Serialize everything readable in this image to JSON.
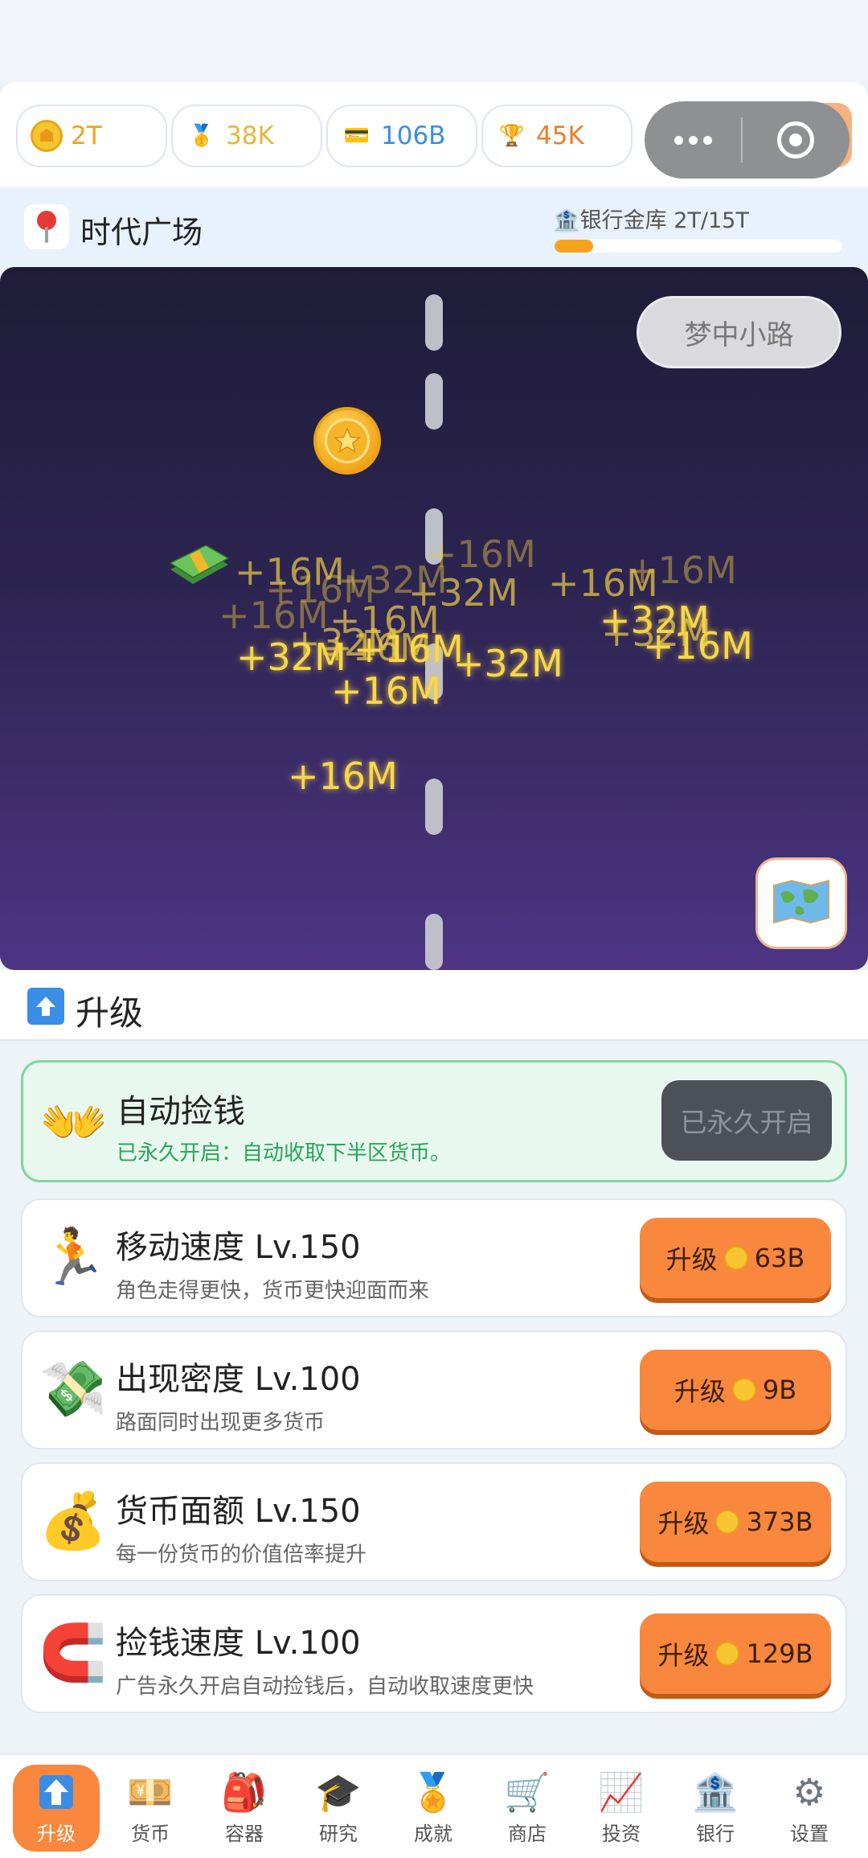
{
  "stats": [
    {
      "name": "coins",
      "icon": "coin-icon",
      "value": "2T",
      "color": "#f0a21b"
    },
    {
      "name": "medal",
      "icon": "medal-icon",
      "value": "38K",
      "color": "#e9b63a"
    },
    {
      "name": "card",
      "icon": "card-icon",
      "value": "106B",
      "color": "#3a8ee6"
    },
    {
      "name": "trophy",
      "icon": "trophy-icon",
      "value": "45K",
      "color": "#ef7d2a"
    }
  ],
  "location": {
    "name": "时代广场",
    "vault_label": "🏦银行金库  2T/15T",
    "vault_progress": 0.133
  },
  "game": {
    "place_button": "梦中小路",
    "floats": [
      "+16M",
      "+16M",
      "+32M",
      "+32M",
      "+16M",
      "+16M",
      "+32M",
      "+32M",
      "+16M",
      "+16M",
      "+32M",
      "+16M",
      "+16M",
      "+16M",
      "+16M",
      "+32M",
      "+16M",
      "+32M",
      "+16M"
    ]
  },
  "upgrade_header": "升级",
  "auto_pick": {
    "title": "自动捡钱",
    "desc": "已永久开启：自动收取下半区货币。",
    "button": "已永久开启"
  },
  "upgrades": [
    {
      "title": "移动速度  Lv.150",
      "desc": "角色走得更快，货币更快迎面而来",
      "btn_label": "升级",
      "cost": "63B",
      "icon": "runner-icon"
    },
    {
      "title": "出现密度  Lv.100",
      "desc": "路面同时出现更多货币",
      "btn_label": "升级",
      "cost": "9B",
      "icon": "money-wings-icon"
    },
    {
      "title": "货币面额  Lv.150",
      "desc": "每一份货币的价值倍率提升",
      "btn_label": "升级",
      "cost": "373B",
      "icon": "money-bag-icon"
    },
    {
      "title": "捡钱速度  Lv.100",
      "desc": "广告永久开启自动捡钱后，自动收取速度更快",
      "btn_label": "升级",
      "cost": "129B",
      "icon": "magnet-icon"
    }
  ],
  "tabs": [
    {
      "label": "升级",
      "icon": "upgrade-icon",
      "glyph": "⬆"
    },
    {
      "label": "货币",
      "icon": "currency-icon",
      "glyph": "💴"
    },
    {
      "label": "容器",
      "icon": "backpack-icon",
      "glyph": "🎒"
    },
    {
      "label": "研究",
      "icon": "graduation-cap-icon",
      "glyph": "🎓"
    },
    {
      "label": "成就",
      "icon": "medal-icon",
      "glyph": "🏅"
    },
    {
      "label": "商店",
      "icon": "cart-icon",
      "glyph": "🛒"
    },
    {
      "label": "投资",
      "icon": "chart-icon",
      "glyph": "📈"
    },
    {
      "label": "银行",
      "icon": "bank-icon",
      "glyph": "🏦"
    },
    {
      "label": "设置",
      "icon": "gear-icon",
      "glyph": "⚙"
    }
  ]
}
